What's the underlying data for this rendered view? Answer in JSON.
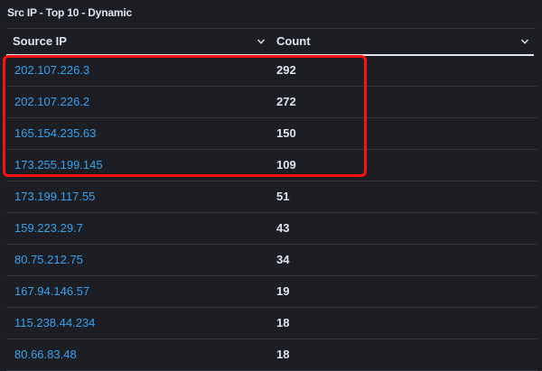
{
  "panel": {
    "title": "Src IP - Top 10 - Dynamic"
  },
  "table": {
    "columns": [
      {
        "label": "Source IP",
        "sort_icon": "chevron-down-icon"
      },
      {
        "label": "Count",
        "sort_icon": "chevron-down-icon"
      }
    ],
    "rows": [
      {
        "ip": "202.107.226.3",
        "count": "292"
      },
      {
        "ip": "202.107.226.2",
        "count": "272"
      },
      {
        "ip": "165.154.235.63",
        "count": "150"
      },
      {
        "ip": "173.255.199.145",
        "count": "109"
      },
      {
        "ip": "173.199.117.55",
        "count": "51"
      },
      {
        "ip": "159.223.29.7",
        "count": "43"
      },
      {
        "ip": "80.75.212.75",
        "count": "34"
      },
      {
        "ip": "167.94.146.57",
        "count": "19"
      },
      {
        "ip": "115.238.44.234",
        "count": "18"
      },
      {
        "ip": "80.66.83.48",
        "count": "18"
      }
    ]
  },
  "colors": {
    "background": "#1d1e24",
    "link": "#36a2ef",
    "text": "#dfe5ef",
    "divider": "#343741",
    "highlight": "#ff1111"
  }
}
